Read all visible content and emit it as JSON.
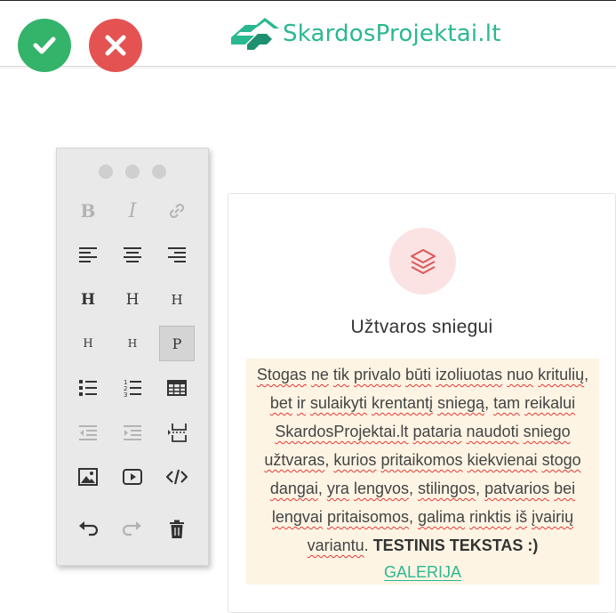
{
  "header": {
    "logo_text": "SkardosProjektai.lt",
    "ok_icon": "checkmark-icon",
    "cancel_icon": "close-icon",
    "colors": {
      "ok": "#34b36a",
      "cancel": "#e45252",
      "brand": "#2ab891"
    }
  },
  "toolbar": {
    "format": [
      "B",
      "I"
    ],
    "headings": [
      "H",
      "H",
      "H",
      "H",
      "H"
    ],
    "paragraph": "P",
    "icons": [
      "bold-icon",
      "italic-icon",
      "link-icon",
      "align-left-icon",
      "align-center-icon",
      "align-right-icon",
      "h1-icon",
      "h2-icon",
      "h3-icon",
      "h4-icon",
      "h5-icon",
      "paragraph-icon",
      "bullet-list-icon",
      "numbered-list-icon",
      "table-icon",
      "outdent-icon",
      "indent-icon",
      "page-break-icon",
      "image-icon",
      "video-icon",
      "code-icon",
      "undo-icon",
      "redo-icon",
      "delete-icon"
    ]
  },
  "card": {
    "icon": "layers-icon",
    "title": "Užtvaros sniegui",
    "paragraph_words": [
      "Stogas",
      " ",
      "ne",
      " ",
      "tik",
      " ",
      "privalo",
      " ",
      "būti",
      " ",
      "izoliuotas",
      " ",
      "nuo",
      " ",
      "kritulių",
      ",",
      " ",
      "bet",
      " ",
      "ir",
      " ",
      "sulaikyti",
      " ",
      "krentantį",
      " ",
      "sniegą",
      ", ",
      "tam",
      " ",
      "reikalui",
      " ",
      "SkardosProjektai.lt",
      " ",
      "pataria",
      " ",
      "naudoti",
      " ",
      "sniego",
      " ",
      "užtvaras",
      ", ",
      "kurios",
      " ",
      "pritaikomos",
      " ",
      "kiekvienai",
      " ",
      "stogo",
      " ",
      "dangai",
      ", ",
      "yra",
      " ",
      "lengvos",
      ", ",
      "stilingos",
      ", ",
      "patvarios",
      " ",
      "bei",
      " ",
      "lengvai",
      " ",
      "pritaisomos",
      ", ",
      "galima",
      " ",
      "rinktis",
      " ",
      "iš",
      " ",
      "įvairių",
      " ",
      "variantu",
      ". "
    ],
    "bold_text": "TESTINIS TEKSTAS :)",
    "link_text": "GALERIJA",
    "colors": {
      "icon_bg": "#fbe3e3",
      "icon": "#e05555",
      "text_bg": "#fdf4e4",
      "link": "#2ab891"
    }
  }
}
